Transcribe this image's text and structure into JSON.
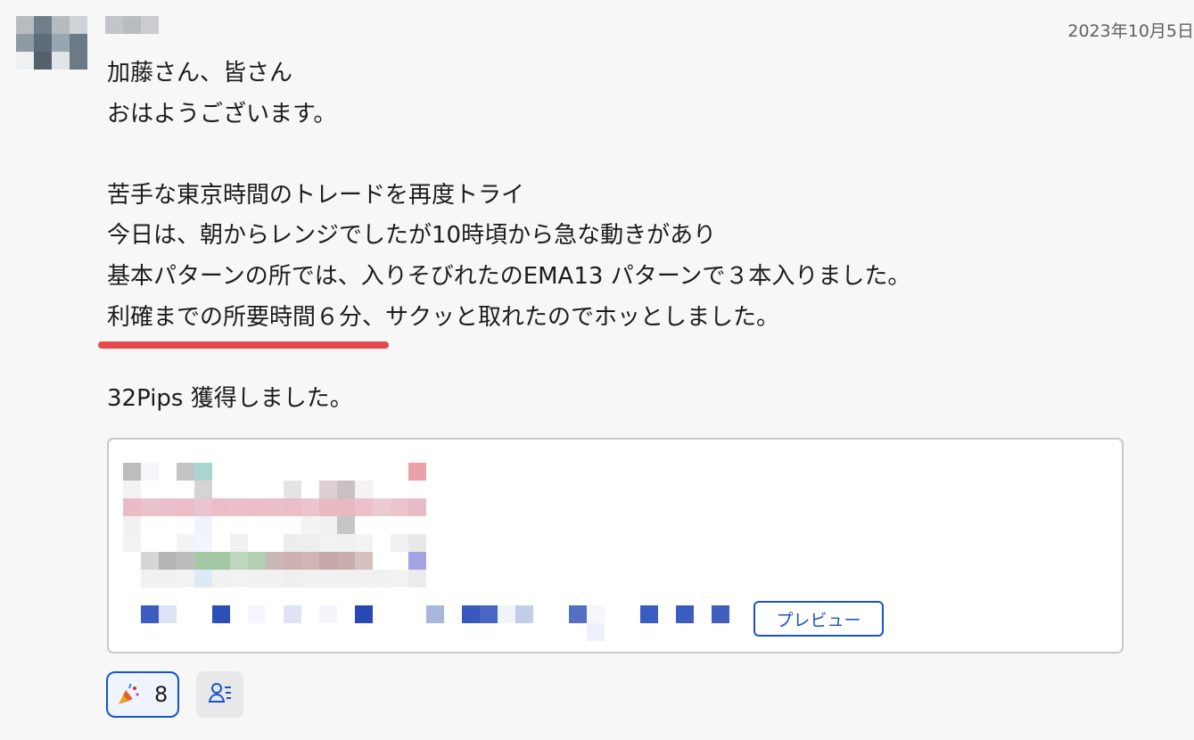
{
  "message": {
    "timestamp": "2023年10月5日",
    "lines": [
      "加藤さん、皆さん",
      "おはようございます。",
      "",
      "苦手な東京時間のトレードを再度トライ",
      "今日は、朝からレンジでしたが10時頃から急な動きがあり",
      "基本パターンの所では、入りそびれたのEMA13 パターンで３本入りました。"
    ],
    "highlight_line": {
      "underlined": "利確までの所要時間６分、",
      "rest": "サクッと取れたのでホッとしました。"
    },
    "closing_lines": [
      "",
      "32Pips 獲得しました。"
    ]
  },
  "attachment": {
    "preview_label": "プレビュー"
  },
  "reactions": {
    "count": "8",
    "emoji_icon": "tada-icon",
    "user_list_icon": "user-list-icon"
  },
  "colors": {
    "accent": "#1a54c4",
    "underline": "#e5484d"
  }
}
